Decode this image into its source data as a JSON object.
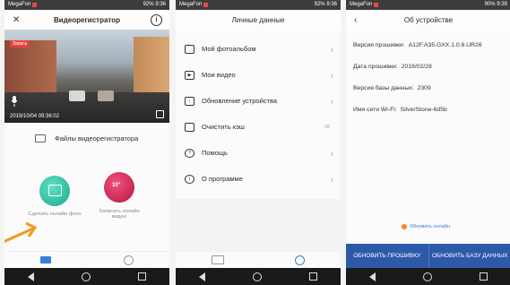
{
  "status": {
    "carrier": "MegaFon",
    "battery1": "92%",
    "battery2": "92%",
    "battery3": "90%",
    "time": "9:36",
    "time3": "9:39"
  },
  "screen1": {
    "title": "Видеорегистратор",
    "record_tag": "Запись",
    "timestamp": "2019/10/04 09:36:02",
    "files_label": "Файлы видеорегистратора",
    "photo_label": "Сделать онлайн фото",
    "video_label": "Записать онлайн видео",
    "video_btn_text": "10\""
  },
  "screen2": {
    "title": "Личные данные",
    "items": [
      {
        "label": "Мой фотоальбом",
        "icon": "photo-icon"
      },
      {
        "label": "Мои видео",
        "icon": "video-icon"
      },
      {
        "label": "Обновление устройства",
        "icon": "upload-icon"
      },
      {
        "label": "Очистить кэш",
        "icon": "cache-icon",
        "size": "0B"
      },
      {
        "label": "Помощь",
        "icon": "help-icon"
      },
      {
        "label": "О программе",
        "icon": "info-icon"
      }
    ]
  },
  "screen3": {
    "title": "Об устройстве",
    "rows": [
      {
        "key": "Версия прошивки:",
        "value": "A12F.A35.GXX.1.0.6.UR26"
      },
      {
        "key": "Дата прошивки:",
        "value": "2019/02/28"
      },
      {
        "key": "Версия базы данных:",
        "value": "2309"
      },
      {
        "key": "Имя сети Wi-Fi:",
        "value": "SilverStone-6d5b"
      }
    ],
    "contact": "Обновить онлайн",
    "btn_firmware": "ОБНОВИТЬ ПРОШИВКУ",
    "btn_db": "ОБНОВИТЬ БАЗУ ДАННЫХ"
  }
}
